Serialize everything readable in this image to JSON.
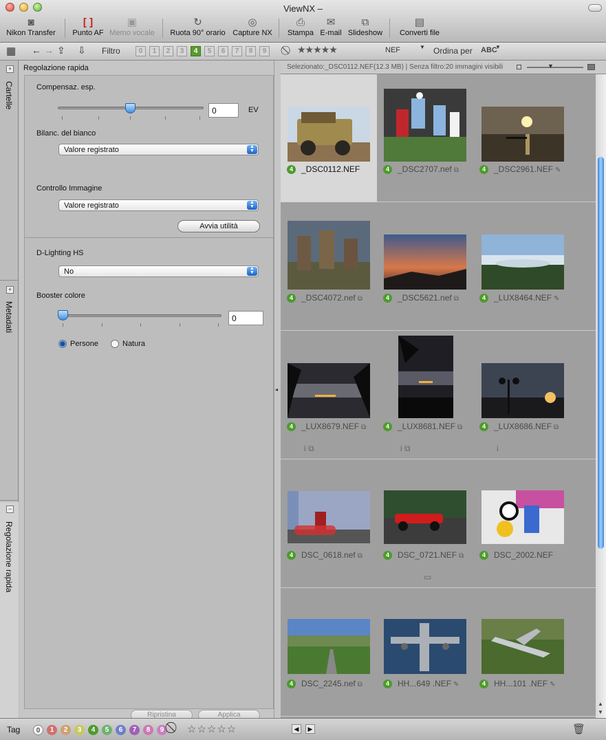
{
  "window": {
    "title": "ViewNX –"
  },
  "toolbar": {
    "buttons": [
      {
        "label": "Nikon Transfer",
        "icon": "camera-icon"
      },
      {
        "label": "Punto AF",
        "icon": "af-point-icon"
      },
      {
        "label": "Memo vocale",
        "icon": "voice-memo-icon"
      },
      {
        "label": "Ruota 90° orario",
        "icon": "rotate-icon"
      },
      {
        "label": "Capture NX",
        "icon": "capture-nx-icon"
      },
      {
        "label": "Stampa",
        "icon": "print-icon"
      },
      {
        "label": "E-mail",
        "icon": "email-icon"
      },
      {
        "label": "Slideshow",
        "icon": "slideshow-icon"
      },
      {
        "label": "Converti file",
        "icon": "convert-icon"
      }
    ]
  },
  "filterbar": {
    "filter_label": "Filtro",
    "numbers": [
      "0",
      "1",
      "2",
      "3",
      "4",
      "5",
      "6",
      "7",
      "8",
      "9"
    ],
    "active_number": "4",
    "stars": "★★★★★",
    "filetype": "NEF",
    "sort_label": "Ordina per",
    "sort_value": "ABC"
  },
  "sidetabs": {
    "folders": "Cartelle",
    "metadata": "Metadati",
    "quick": "Regolazione rapida"
  },
  "panel": {
    "title": "Regolazione rapida",
    "exposure": {
      "label": "Compensaz. esp.",
      "value": "0",
      "unit": "EV",
      "slider_fraction": 0.5
    },
    "white_balance": {
      "label": "Bilanc. del bianco",
      "value": "Valore registrato"
    },
    "picture_control": {
      "label": "Controllo Immagine",
      "value": "Valore registrato",
      "utility_button": "Avvia utilità"
    },
    "dlighting": {
      "label": "D-Lighting HS",
      "value": "No"
    },
    "color_booster": {
      "label": "Booster colore",
      "value": "0",
      "slider_fraction": 0,
      "options": [
        "Persone",
        "Natura"
      ],
      "selected": "Persone"
    },
    "reset_button": "Ripristina",
    "apply_button": "Applica"
  },
  "browser": {
    "info": "Selezionato:_DSC0112.NEF(12.3 MB) | Senza filtro:20 immagini visibili",
    "images": [
      {
        "name": "_DSC0112.NEF",
        "label": "4",
        "selected": true,
        "extra": "",
        "below": ""
      },
      {
        "name": "_DSC2707.nef",
        "label": "4",
        "selected": false,
        "extra": "⧉",
        "below": ""
      },
      {
        "name": "_DSC2961.NEF",
        "label": "4",
        "selected": false,
        "extra": "✎",
        "below": ""
      },
      {
        "name": "_DSC4072.nef",
        "label": "4",
        "selected": false,
        "extra": "⧉",
        "below": ""
      },
      {
        "name": "_DSC5621.nef",
        "label": "4",
        "selected": false,
        "extra": "⧉",
        "below": ""
      },
      {
        "name": "_LUX8464.NEF",
        "label": "4",
        "selected": false,
        "extra": "✎",
        "below": ""
      },
      {
        "name": "_LUX8679.NEF",
        "label": "4",
        "selected": false,
        "extra": "⧉",
        "below": "i ⧉"
      },
      {
        "name": "_LUX8681.NEF",
        "label": "4",
        "selected": false,
        "extra": "⧉",
        "below": "i ⧉"
      },
      {
        "name": "_LUX8686.NEF",
        "label": "4",
        "selected": false,
        "extra": "⧉",
        "below": "i"
      },
      {
        "name": "DSC_0618.nef",
        "label": "4",
        "selected": false,
        "extra": "⧉",
        "below": ""
      },
      {
        "name": "DSC_0721.NEF",
        "label": "4",
        "selected": false,
        "extra": "⧉",
        "below": "▭"
      },
      {
        "name": "DSC_2002.NEF",
        "label": "4",
        "selected": false,
        "extra": "",
        "below": ""
      },
      {
        "name": "DSC_2245.nef",
        "label": "4",
        "selected": false,
        "extra": "⧉",
        "below": ""
      },
      {
        "name": "HH...649 .NEF",
        "label": "4",
        "selected": false,
        "extra": "✎",
        "below": ""
      },
      {
        "name": "HH...101 .NEF",
        "label": "4",
        "selected": false,
        "extra": "✎",
        "below": ""
      }
    ]
  },
  "statusbar": {
    "tag_label": "Tag",
    "tags": [
      "0",
      "1",
      "2",
      "3",
      "4",
      "5",
      "6",
      "7",
      "8",
      "9"
    ],
    "stars": "☆☆☆☆☆"
  },
  "colors": {
    "label_green": "#4e9a2c",
    "accent_blue": "#3d86d6"
  }
}
